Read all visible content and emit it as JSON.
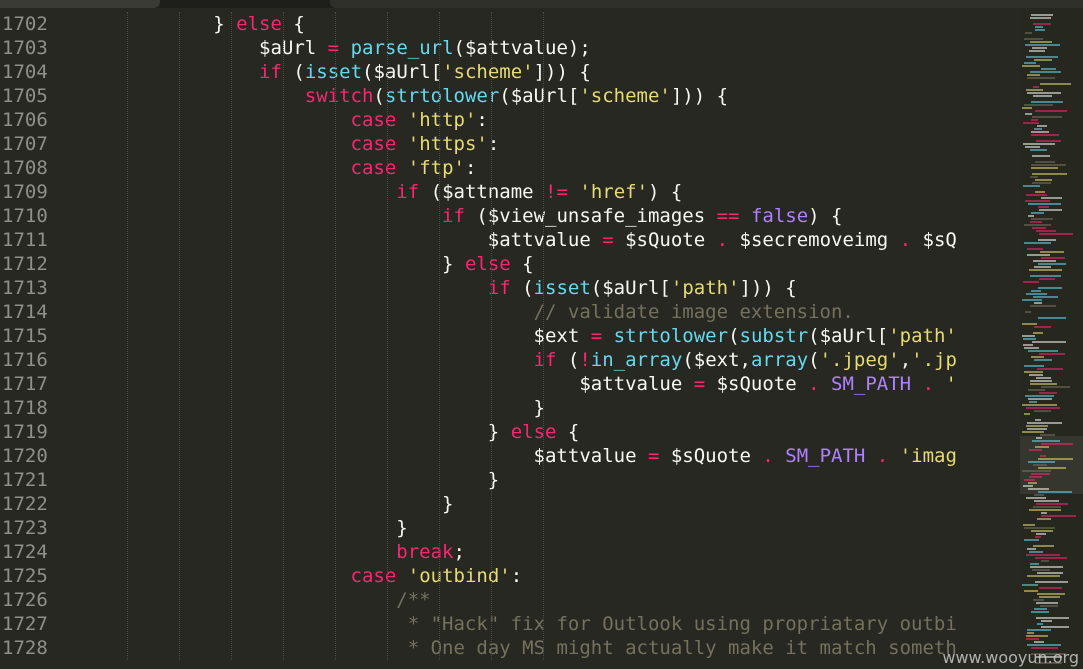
{
  "line_numbers": [
    "1702",
    "1703",
    "1704",
    "1705",
    "1706",
    "1707",
    "1708",
    "1709",
    "1710",
    "1711",
    "1712",
    "1713",
    "1714",
    "1715",
    "1716",
    "1717",
    "1718",
    "1719",
    "1720",
    "1721",
    "1722",
    "1723",
    "1724",
    "1725",
    "1726",
    "1727",
    "1728"
  ],
  "code_lines": [
    [
      {
        "t": "            } "
      },
      {
        "t": "else",
        "c": "k"
      },
      {
        "t": " {"
      }
    ],
    [
      {
        "t": "                $aUrl "
      },
      {
        "t": "=",
        "c": "k"
      },
      {
        "t": " "
      },
      {
        "t": "parse_url",
        "c": "f"
      },
      {
        "t": "($attvalue);"
      }
    ],
    [
      {
        "t": "                "
      },
      {
        "t": "if",
        "c": "k"
      },
      {
        "t": " ("
      },
      {
        "t": "isset",
        "c": "f"
      },
      {
        "t": "($aUrl["
      },
      {
        "t": "'scheme'",
        "c": "s"
      },
      {
        "t": "])) {"
      }
    ],
    [
      {
        "t": "                    "
      },
      {
        "t": "switch",
        "c": "k"
      },
      {
        "t": "("
      },
      {
        "t": "strtolower",
        "c": "f"
      },
      {
        "t": "($aUrl["
      },
      {
        "t": "'scheme'",
        "c": "s"
      },
      {
        "t": "])) {"
      }
    ],
    [
      {
        "t": "                        "
      },
      {
        "t": "case",
        "c": "k"
      },
      {
        "t": " "
      },
      {
        "t": "'http'",
        "c": "s"
      },
      {
        "t": ":"
      }
    ],
    [
      {
        "t": "                        "
      },
      {
        "t": "case",
        "c": "k"
      },
      {
        "t": " "
      },
      {
        "t": "'https'",
        "c": "s"
      },
      {
        "t": ":"
      }
    ],
    [
      {
        "t": "                        "
      },
      {
        "t": "case",
        "c": "k"
      },
      {
        "t": " "
      },
      {
        "t": "'ftp'",
        "c": "s"
      },
      {
        "t": ":"
      }
    ],
    [
      {
        "t": "                            "
      },
      {
        "t": "if",
        "c": "k"
      },
      {
        "t": " ($attname "
      },
      {
        "t": "!=",
        "c": "k"
      },
      {
        "t": " "
      },
      {
        "t": "'href'",
        "c": "s"
      },
      {
        "t": ") {"
      }
    ],
    [
      {
        "t": "                                "
      },
      {
        "t": "if",
        "c": "k"
      },
      {
        "t": " ($view_unsafe_images "
      },
      {
        "t": "==",
        "c": "k"
      },
      {
        "t": " "
      },
      {
        "t": "false",
        "c": "b"
      },
      {
        "t": ") {"
      }
    ],
    [
      {
        "t": "                                    $attvalue "
      },
      {
        "t": "=",
        "c": "k"
      },
      {
        "t": " $sQuote "
      },
      {
        "t": ".",
        "c": "k"
      },
      {
        "t": " $secremoveimg "
      },
      {
        "t": ".",
        "c": "k"
      },
      {
        "t": " $sQ"
      }
    ],
    [
      {
        "t": "                                } "
      },
      {
        "t": "else",
        "c": "k"
      },
      {
        "t": " {"
      }
    ],
    [
      {
        "t": "                                    "
      },
      {
        "t": "if",
        "c": "k"
      },
      {
        "t": " ("
      },
      {
        "t": "isset",
        "c": "f"
      },
      {
        "t": "($aUrl["
      },
      {
        "t": "'path'",
        "c": "s"
      },
      {
        "t": "])) {"
      }
    ],
    [
      {
        "t": "                                        "
      },
      {
        "t": "// validate image extension.",
        "c": "c"
      }
    ],
    [
      {
        "t": "                                        $ext "
      },
      {
        "t": "=",
        "c": "k"
      },
      {
        "t": " "
      },
      {
        "t": "strtolower",
        "c": "f"
      },
      {
        "t": "("
      },
      {
        "t": "substr",
        "c": "f"
      },
      {
        "t": "($aUrl["
      },
      {
        "t": "'path'",
        "c": "s"
      }
    ],
    [
      {
        "t": "                                        "
      },
      {
        "t": "if",
        "c": "k"
      },
      {
        "t": " ("
      },
      {
        "t": "!",
        "c": "k"
      },
      {
        "t": "in_array",
        "c": "f"
      },
      {
        "t": "($ext,"
      },
      {
        "t": "array",
        "c": "f"
      },
      {
        "t": "("
      },
      {
        "t": "'.jpeg'",
        "c": "s"
      },
      {
        "t": ","
      },
      {
        "t": "'.jp",
        "c": "s"
      }
    ],
    [
      {
        "t": "                                            $attvalue "
      },
      {
        "t": "=",
        "c": "k"
      },
      {
        "t": " $sQuote "
      },
      {
        "t": ".",
        "c": "k"
      },
      {
        "t": " "
      },
      {
        "t": "SM_PATH",
        "c": "b"
      },
      {
        "t": " "
      },
      {
        "t": ".",
        "c": "k"
      },
      {
        "t": " "
      },
      {
        "t": "'",
        "c": "s"
      }
    ],
    [
      {
        "t": "                                        }"
      }
    ],
    [
      {
        "t": "                                    } "
      },
      {
        "t": "else",
        "c": "k"
      },
      {
        "t": " {"
      }
    ],
    [
      {
        "t": "                                        $attvalue "
      },
      {
        "t": "=",
        "c": "k"
      },
      {
        "t": " $sQuote "
      },
      {
        "t": ".",
        "c": "k"
      },
      {
        "t": " "
      },
      {
        "t": "SM_PATH",
        "c": "b"
      },
      {
        "t": " "
      },
      {
        "t": ".",
        "c": "k"
      },
      {
        "t": " "
      },
      {
        "t": "'imag",
        "c": "s"
      }
    ],
    [
      {
        "t": "                                    }"
      }
    ],
    [
      {
        "t": "                                }"
      }
    ],
    [
      {
        "t": "                            }"
      }
    ],
    [
      {
        "t": "                            "
      },
      {
        "t": "break",
        "c": "k"
      },
      {
        "t": ";"
      }
    ],
    [
      {
        "t": "                        "
      },
      {
        "t": "case",
        "c": "k"
      },
      {
        "t": " "
      },
      {
        "t": "'outbind'",
        "c": "s"
      },
      {
        "t": ":"
      }
    ],
    [
      {
        "t": "                            "
      },
      {
        "t": "/**",
        "c": "c"
      }
    ],
    [
      {
        "t": "                             "
      },
      {
        "t": "* \"Hack\" fix for Outlook using propriatary outbi",
        "c": "c"
      }
    ],
    [
      {
        "t": "                             "
      },
      {
        "t": "* One day MS might actually make it match someth",
        "c": "c"
      }
    ]
  ],
  "colors": {
    "background": "#272822",
    "keyword": "#f92672",
    "function": "#66d9ef",
    "string": "#e6db74",
    "comment": "#75715e",
    "constant": "#ae81ff",
    "text": "#f8f8f2",
    "gutter_text": "#8f908a"
  },
  "watermark": {
    "text": "www.wooyun.org"
  }
}
